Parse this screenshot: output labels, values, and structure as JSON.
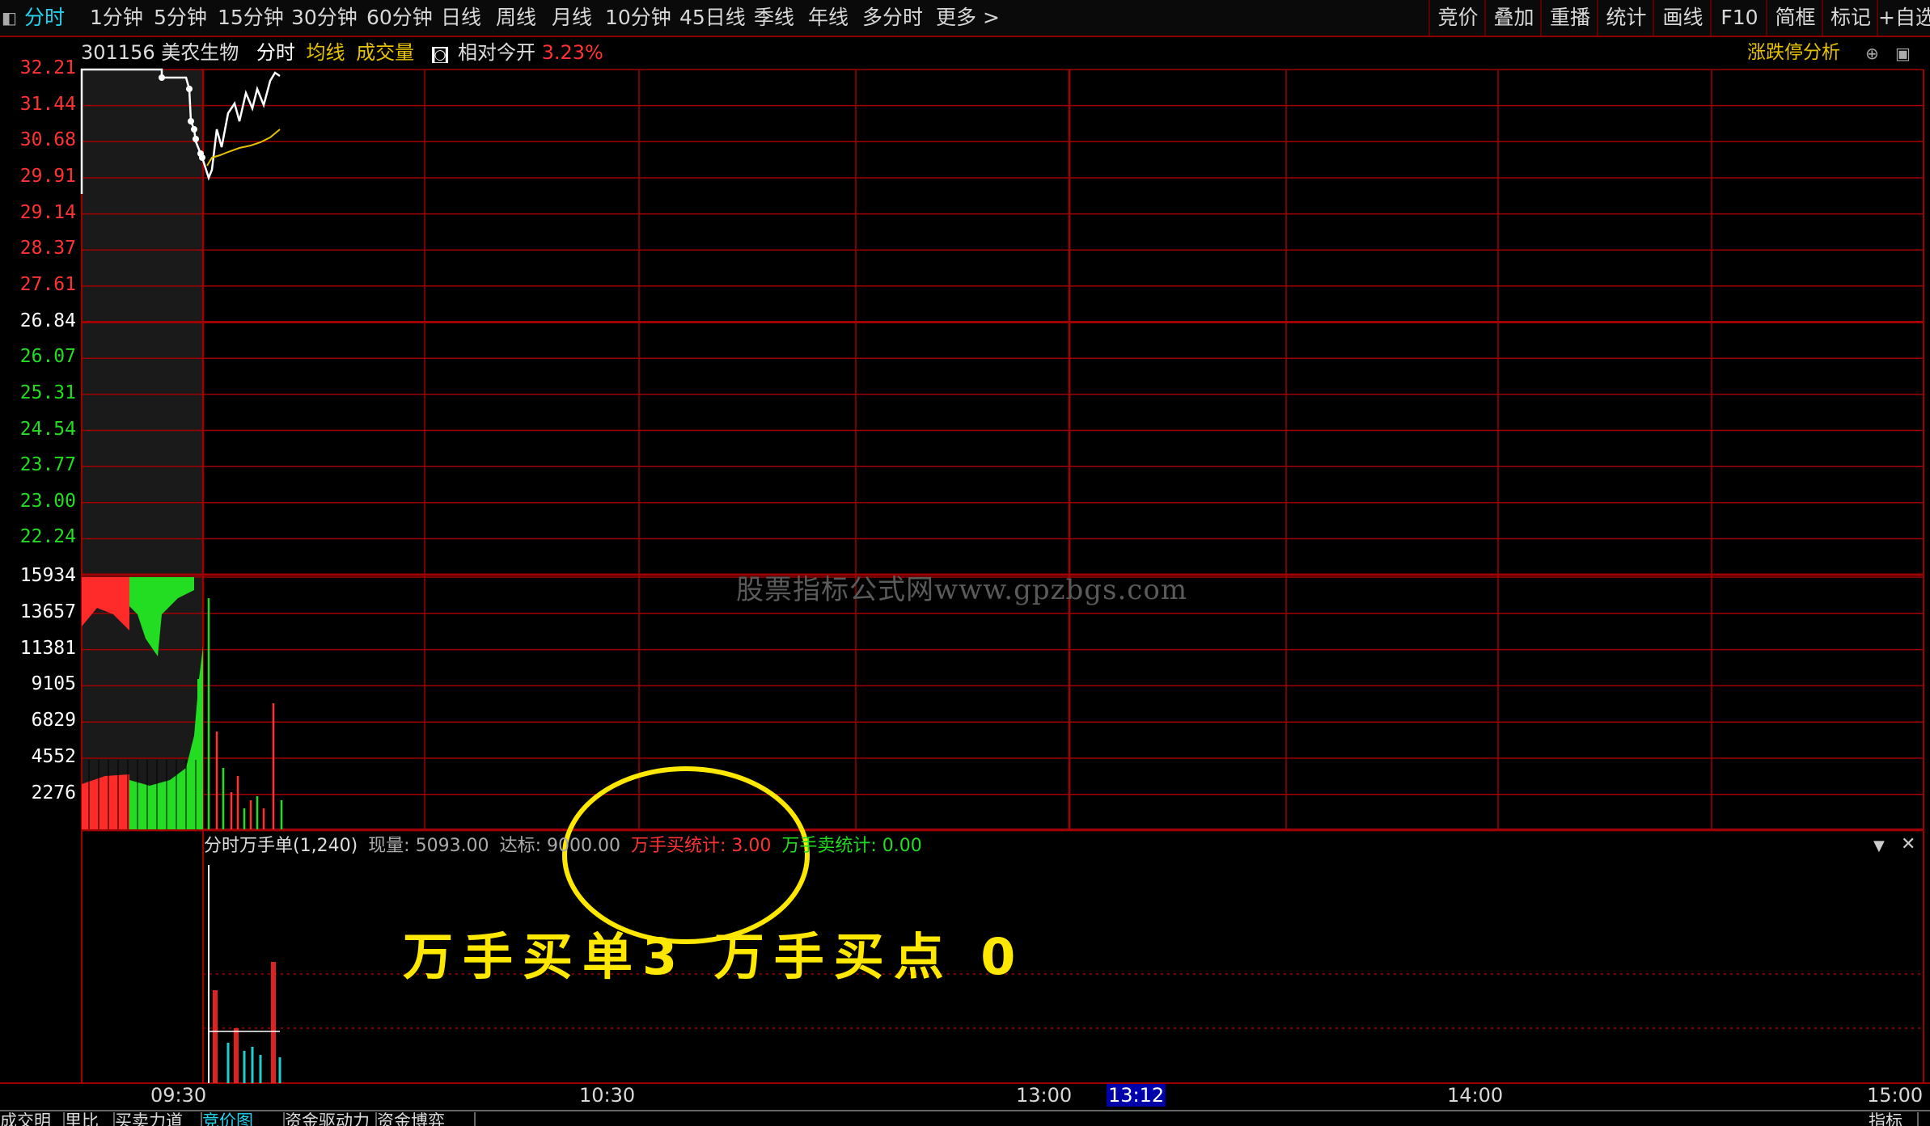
{
  "toolbar": {
    "left_tabs": [
      "分时",
      "1分钟",
      "5分钟",
      "15分钟",
      "30分钟",
      "60分钟",
      "日线",
      "周线",
      "月线",
      "10分钟",
      "45日线",
      "季线",
      "年线",
      "多分时",
      "更多 >"
    ],
    "right_buttons": [
      "竞价",
      "叠加",
      "重播",
      "统计",
      "画线",
      "F10",
      "简框",
      "标记",
      "+自选"
    ]
  },
  "header": {
    "code": "301156",
    "name": "美农生物",
    "mode": "分时",
    "avg_line": "均线",
    "volume": "成交量",
    "relative_label": "相对今开",
    "relative_value": "3.23%",
    "analysis": "涨跌停分析"
  },
  "price_axis": [
    "32.21",
    "31.44",
    "30.68",
    "29.91",
    "29.14",
    "28.37",
    "27.61",
    "26.84",
    "26.07",
    "25.31",
    "24.54",
    "23.77",
    "23.00",
    "22.24"
  ],
  "volume_axis": [
    "15934",
    "13657",
    "11381",
    "9105",
    "6829",
    "4552",
    "2276"
  ],
  "time_axis": [
    "09:30",
    "10:30",
    "13:00",
    "13:12",
    "14:00",
    "15:00"
  ],
  "indicator": {
    "title": "分时万手单(1,240)",
    "current_label": "现量:",
    "current_value": "5093.00",
    "target_label": "达标:",
    "target_value": "9000.00",
    "buy_label": "万手买统计:",
    "buy_value": "3.00",
    "sell_label": "万手卖统计:",
    "sell_value": "0.00"
  },
  "annotation": "万手买单3 万手买点 0",
  "watermark": "股票指标公式网www.gpzbgs.com",
  "bottom_tabs": [
    "成交明",
    "里比",
    "买卖力道",
    "竞价图",
    "资金驱动力",
    "资金博弈"
  ],
  "bottom_right": "指标",
  "colors": {
    "grid": "#a00000",
    "up": "#ff3333",
    "down": "#22dd22",
    "price": "#ffffff",
    "avg": "#e6c200",
    "accent": "#22d3ee",
    "annot": "#ffe800"
  }
}
